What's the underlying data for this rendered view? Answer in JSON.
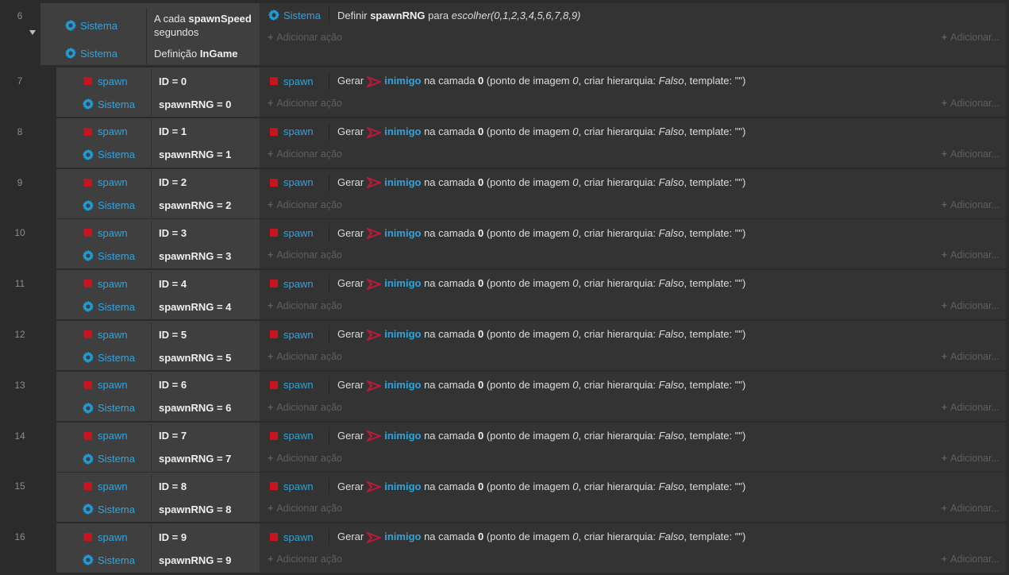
{
  "top_event": {
    "row_number": "6",
    "conditions": [
      {
        "object": "Sistema",
        "text_pre": "A cada ",
        "text_bold": "spawnSpeed",
        "text_post": "segundos"
      },
      {
        "object": "Sistema",
        "text_pre": "Definição ",
        "text_bold": "InGame",
        "text_post": ""
      }
    ],
    "action": {
      "object": "Sistema",
      "text_pre": "Definir ",
      "text_bold": "spawnRNG",
      "text_mid": " para ",
      "text_italic": "escolher(0,1,2,3,4,5,6,7,8,9)"
    },
    "add_action_label": "Adicionar ação",
    "add_right_label": "Adicionar..."
  },
  "sub_events": [
    {
      "row": "7",
      "cond1_obj": "spawn",
      "cond1_text": "ID = 0",
      "cond2_obj": "Sistema",
      "cond2_text": "spawnRNG = 0",
      "act_obj": "spawn"
    },
    {
      "row": "8",
      "cond1_obj": "spawn",
      "cond1_text": "ID = 1",
      "cond2_obj": "Sistema",
      "cond2_text": "spawnRNG = 1",
      "act_obj": "spawn"
    },
    {
      "row": "9",
      "cond1_obj": "spawn",
      "cond1_text": "ID = 2",
      "cond2_obj": "Sistema",
      "cond2_text": "spawnRNG = 2",
      "act_obj": "spawn"
    },
    {
      "row": "10",
      "cond1_obj": "spawn",
      "cond1_text": "ID = 3",
      "cond2_obj": "Sistema",
      "cond2_text": "spawnRNG = 3",
      "act_obj": "spawn"
    },
    {
      "row": "11",
      "cond1_obj": "spawn",
      "cond1_text": "ID = 4",
      "cond2_obj": "Sistema",
      "cond2_text": "spawnRNG = 4",
      "act_obj": "spawn"
    },
    {
      "row": "12",
      "cond1_obj": "spawn",
      "cond1_text": "ID = 5",
      "cond2_obj": "Sistema",
      "cond2_text": "spawnRNG = 5",
      "act_obj": "spawn"
    },
    {
      "row": "13",
      "cond1_obj": "spawn",
      "cond1_text": "ID = 6",
      "cond2_obj": "Sistema",
      "cond2_text": "spawnRNG = 6",
      "act_obj": "spawn"
    },
    {
      "row": "14",
      "cond1_obj": "spawn",
      "cond1_text": "ID = 7",
      "cond2_obj": "Sistema",
      "cond2_text": "spawnRNG = 7",
      "act_obj": "spawn"
    },
    {
      "row": "15",
      "cond1_obj": "spawn",
      "cond1_text": "ID = 8",
      "cond2_obj": "Sistema",
      "cond2_text": "spawnRNG = 8",
      "act_obj": "spawn"
    },
    {
      "row": "16",
      "cond1_obj": "spawn",
      "cond1_text": "ID = 9",
      "cond2_obj": "Sistema",
      "cond2_text": "spawnRNG = 9",
      "act_obj": "spawn"
    }
  ],
  "spawn_action": {
    "verb": "Gerar",
    "object": "inimigo",
    "text_a": " na camada ",
    "layer": "0",
    "text_b": " (ponto de imagem ",
    "image_point": "0",
    "text_c": ", criar hierarquia: ",
    "hierarchy": "Falso",
    "text_d": ", template: \"\")"
  },
  "colors": {
    "object_name": "#31a4dd",
    "spawn_icon": "#c8141e",
    "gear_icon": "#1c9bd6",
    "inimigo_arrow": "#c0183c"
  },
  "icons": {
    "system": "gear-icon",
    "spawn": "red-square-icon",
    "inimigo": "arrow-sprite-icon",
    "collapse": "collapse-arrow-icon"
  }
}
